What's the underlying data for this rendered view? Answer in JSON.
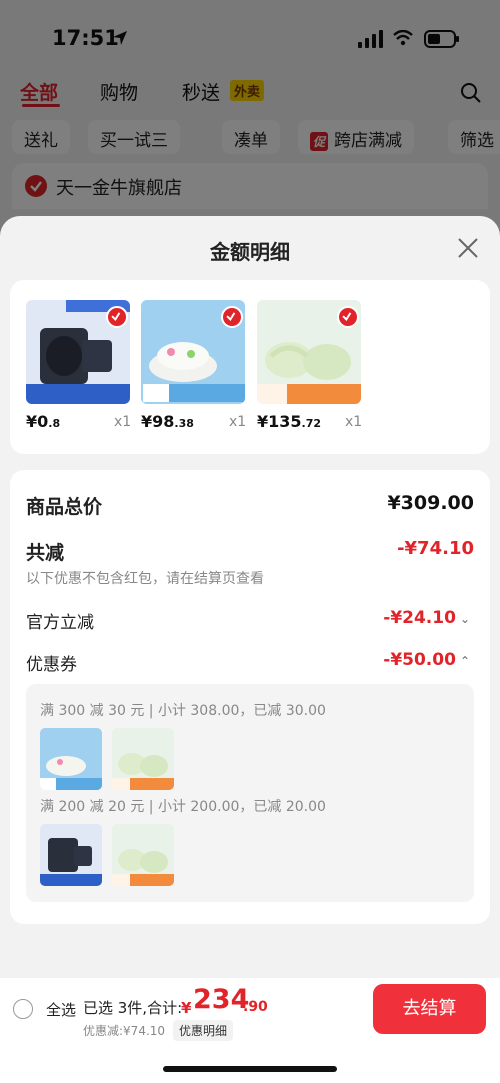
{
  "status_bar": {
    "time": "17:51"
  },
  "tabs": {
    "all": "全部",
    "shopping": "购物",
    "flash": "秒送",
    "flash_badge": "外卖"
  },
  "filters": {
    "gift": "送礼",
    "buy_try": "买一试三",
    "bundle": "凑单",
    "cross_store_tag": "促",
    "cross_store": "跨店满减",
    "filter": "筛选"
  },
  "store": {
    "name": "天一金牛旗舰店"
  },
  "sheet": {
    "title": "金额明细"
  },
  "products": [
    {
      "price_int": "¥0",
      "price_dec": ".8",
      "qty": "x1"
    },
    {
      "price_int": "¥98",
      "price_dec": ".38",
      "qty": "x1"
    },
    {
      "price_int": "¥135",
      "price_dec": ".72",
      "qty": "x1"
    }
  ],
  "detail": {
    "total_label": "商品总价",
    "total_value": "¥309.00",
    "reduce_label": "共减",
    "reduce_value": "-¥74.10",
    "reduce_note": "以下优惠不包含红包，请在结算页查看",
    "official_label": "官方立减",
    "official_value": "-¥24.10",
    "coupon_label": "优惠券",
    "coupon_value": "-¥50.00"
  },
  "coupons": [
    {
      "line": "满 300 减 30 元 | 小计 308.00，已减 30.00"
    },
    {
      "line": "满 200 减 20 元 | 小计 200.00，已减 20.00"
    }
  ],
  "bottom": {
    "select_all": "全选",
    "summary_prefix": "已选 3件,合计:",
    "yen": "¥",
    "total_int": "234",
    "total_dec": ".90",
    "discount_text": "优惠减:¥74.10",
    "discount_btn": "优惠明细",
    "checkout": "去结算"
  },
  "colors": {
    "accent": "#e0242a",
    "checkout": "#f0303a"
  }
}
